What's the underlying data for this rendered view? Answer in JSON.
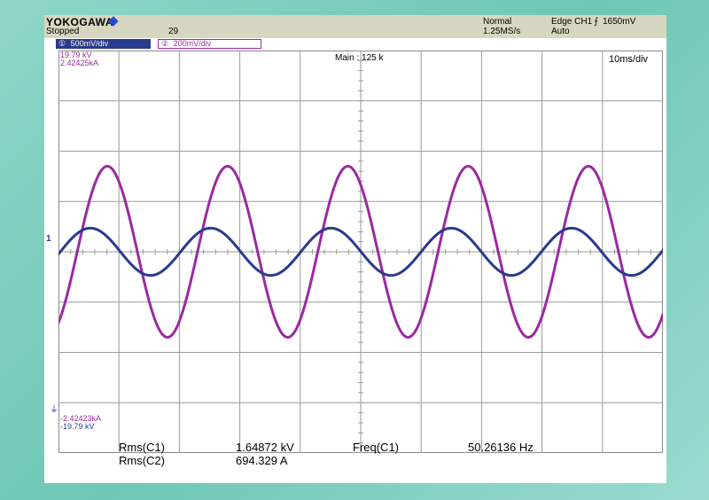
{
  "status": {
    "brand": "YOKOGAWA",
    "state": "Stopped",
    "count": "29",
    "mode": "Normal",
    "sample_rate": "1.25MS/s",
    "trigger": "Edge CH1",
    "trigger_level": "1650mV",
    "trigger_mode": "Auto"
  },
  "channels": {
    "ch1": {
      "icon": "1",
      "scale": "500mV/div",
      "color": "#2a3a8c"
    },
    "ch2": {
      "icon": "2",
      "scale": "200mV/div",
      "color": "#9a2aa0"
    }
  },
  "screen": {
    "top_ch2": "19.79 kV",
    "top_ch1": "2.42425kA",
    "zoom": "Main : 125 k",
    "timebase": "10ms/div",
    "bottom_ch1": "-2.42423kA",
    "bottom_ch2": "-19.79 kV",
    "ground_marker": "1"
  },
  "measurements": [
    {
      "label": "Rms(C1)",
      "value": "1.64872 kV"
    },
    {
      "label": "Rms(C2)",
      "value": "694.329 A"
    },
    {
      "label": "Freq(C1)",
      "value": "50.26136 Hz"
    }
  ],
  "chart_data": {
    "type": "line",
    "grid": true,
    "divisions": {
      "x": 10,
      "y": 8
    },
    "xlim_div": [
      0,
      10
    ],
    "ylim_div": [
      -4,
      4
    ],
    "series": [
      {
        "color": "#9a2aa0",
        "amplitude_div": 1.7,
        "offset_div": 0.0,
        "period_div": 1.99,
        "phase_div": 0.31
      },
      {
        "color": "#2a3a8c",
        "amplitude_div": 0.47,
        "offset_div": 0.0,
        "period_div": 1.99,
        "phase_div": 0.03
      }
    ]
  }
}
